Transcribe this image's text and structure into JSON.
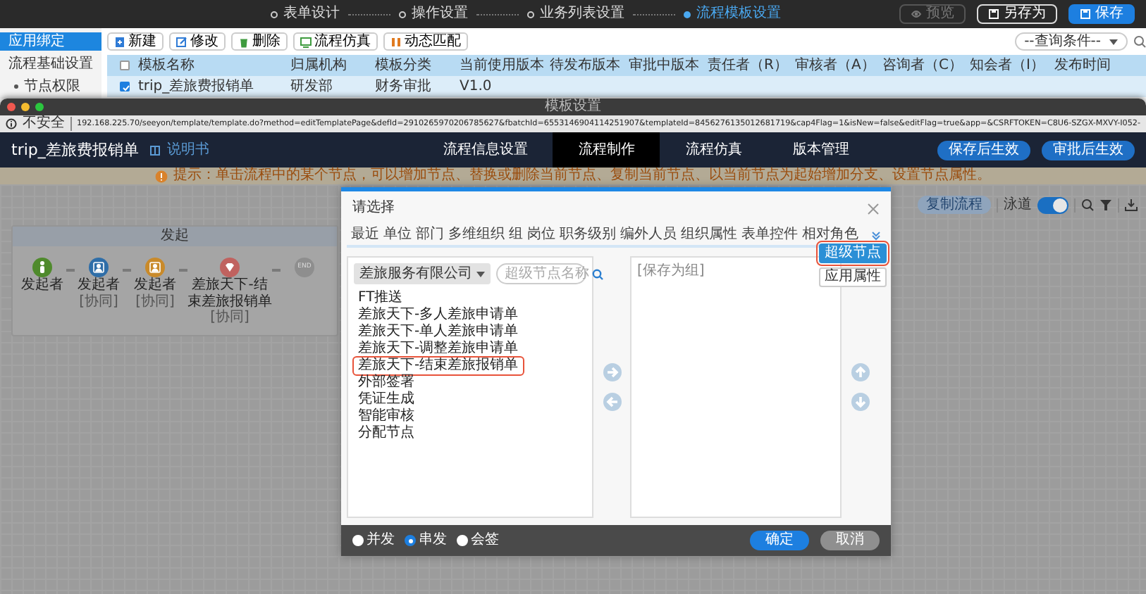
{
  "editor_header": {
    "steps": [
      {
        "label": "表单设计",
        "selected": false
      },
      {
        "label": "操作设置",
        "selected": false
      },
      {
        "label": "业务列表设置",
        "selected": false
      },
      {
        "label": "流程模板设置",
        "selected": true
      }
    ],
    "buttons": [
      {
        "label": "预览",
        "kind": "preview",
        "disabled": true
      },
      {
        "label": "另存为",
        "kind": "outline",
        "disabled": false
      },
      {
        "label": "保存",
        "kind": "primary",
        "disabled": false
      }
    ]
  },
  "sidebar": {
    "items": [
      {
        "label": "应用绑定",
        "selected": true
      },
      {
        "label": "流程基础设置",
        "selected": false,
        "children": [
          {
            "label": "节点权限",
            "selected": false
          }
        ]
      }
    ]
  },
  "toolbar": {
    "buttons": [
      "新建",
      "修改",
      "删除",
      "流程仿真",
      "动态匹配"
    ],
    "query": {
      "value": "--查询条件--"
    }
  },
  "table": {
    "columns": [
      "模板名称",
      "归属机构",
      "模板分类",
      "当前使用版本",
      "待发布版本",
      "审批中版本",
      "责任者（R）",
      "审核者（A）",
      "咨询者（C）",
      "知会者（I）",
      "发布时间"
    ],
    "all_selected": false,
    "rows": [
      {
        "selected": true,
        "cells": [
          "trip_差旅费报销单",
          "研发部",
          "财务审批",
          "V1.0"
        ]
      }
    ]
  },
  "window": {
    "title": "模板设置",
    "security": "不安全",
    "url": "192.168.225.70/seeyon/template/template.do?method=editTemplatePage&defId=2910265970206785627&fbatchId=6553146904114251907&templateId=8456276135012681719&cap4Flag=1&isNew=false&editFlag=true&app=&CSRFTOKEN=C8U6-SZGX-MXVY-I052-"
  },
  "app_header": {
    "title": "trip_差旅费报销单",
    "manual_link": "说明书",
    "tabs": [
      {
        "label": "流程信息设置",
        "selected": false
      },
      {
        "label": "流程制作",
        "selected": true
      },
      {
        "label": "流程仿真",
        "selected": false
      },
      {
        "label": "版本管理",
        "selected": false
      }
    ],
    "buttons": [
      "保存后生效",
      "审批后生效"
    ]
  },
  "notice": "提示：单击流程中的某个节点，可以增加节点、替换或删除当前节点、复制当前节点、以当前节点为起始增加分支、设置节点属性。",
  "canvas_toolbar": {
    "copy_button": "复制流程",
    "swimlane": {
      "label": "泳道",
      "on": true
    }
  },
  "flow": {
    "title": "发起",
    "nodes": [
      {
        "kind": "start",
        "label": "发起者",
        "color": "#4f8a2c"
      },
      {
        "kind": "person",
        "label": "发起者",
        "note": "[协同]",
        "color": "#2f6ea8"
      },
      {
        "kind": "person",
        "label": "发起者",
        "note": "[协同]",
        "color": "#c98a2a"
      },
      {
        "kind": "super",
        "label": "差旅天下-结束差旅报销单",
        "note": "[协同]",
        "color": "#c0625f"
      },
      {
        "kind": "end",
        "label": "END",
        "color": "#8e8e8e"
      }
    ]
  },
  "dialog": {
    "title": "请选择",
    "tabs": [
      "最近",
      "单位",
      "部门",
      "多维组织",
      "组",
      "岗位",
      "职务级别",
      "编外人员",
      "组织属性",
      "表单控件",
      "相对角色"
    ],
    "side_buttons": [
      {
        "label": "超级节点",
        "selected": true,
        "highlighted": true
      },
      {
        "label": "应用属性",
        "selected": false,
        "highlighted": false
      }
    ],
    "org_select": {
      "value": "差旅服务有限公司"
    },
    "search": {
      "placeholder": "超级节点名称"
    },
    "items": [
      {
        "label": "FT推送",
        "highlighted": false
      },
      {
        "label": "差旅天下-多人差旅申请单",
        "highlighted": false
      },
      {
        "label": "差旅天下-单人差旅申请单",
        "highlighted": false
      },
      {
        "label": "差旅天下-调整差旅申请单",
        "highlighted": false
      },
      {
        "label": "差旅天下-结束差旅报销单",
        "highlighted": true
      },
      {
        "label": "外部签署",
        "highlighted": false
      },
      {
        "label": "凭证生成",
        "highlighted": false
      },
      {
        "label": "智能审核",
        "highlighted": false
      },
      {
        "label": "分配节点",
        "highlighted": false
      }
    ],
    "selected_header": "[保存为组]",
    "radios": [
      {
        "label": "并发",
        "selected": false
      },
      {
        "label": "串发",
        "selected": true
      },
      {
        "label": "会签",
        "selected": false
      }
    ],
    "buttons": [
      {
        "label": "确定",
        "kind": "primary"
      },
      {
        "label": "取消",
        "kind": "secondary"
      }
    ]
  }
}
